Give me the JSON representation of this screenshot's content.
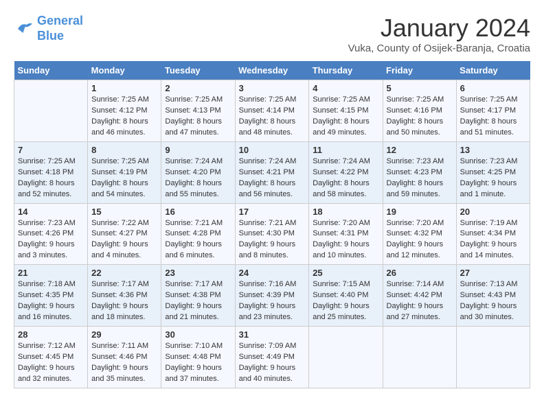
{
  "logo": {
    "line1": "General",
    "line2": "Blue"
  },
  "title": "January 2024",
  "location": "Vuka, County of Osijek-Baranja, Croatia",
  "weekdays": [
    "Sunday",
    "Monday",
    "Tuesday",
    "Wednesday",
    "Thursday",
    "Friday",
    "Saturday"
  ],
  "weeks": [
    [
      {
        "day": "",
        "info": ""
      },
      {
        "day": "1",
        "info": "Sunrise: 7:25 AM\nSunset: 4:12 PM\nDaylight: 8 hours\nand 46 minutes."
      },
      {
        "day": "2",
        "info": "Sunrise: 7:25 AM\nSunset: 4:13 PM\nDaylight: 8 hours\nand 47 minutes."
      },
      {
        "day": "3",
        "info": "Sunrise: 7:25 AM\nSunset: 4:14 PM\nDaylight: 8 hours\nand 48 minutes."
      },
      {
        "day": "4",
        "info": "Sunrise: 7:25 AM\nSunset: 4:15 PM\nDaylight: 8 hours\nand 49 minutes."
      },
      {
        "day": "5",
        "info": "Sunrise: 7:25 AM\nSunset: 4:16 PM\nDaylight: 8 hours\nand 50 minutes."
      },
      {
        "day": "6",
        "info": "Sunrise: 7:25 AM\nSunset: 4:17 PM\nDaylight: 8 hours\nand 51 minutes."
      }
    ],
    [
      {
        "day": "7",
        "info": "Sunrise: 7:25 AM\nSunset: 4:18 PM\nDaylight: 8 hours\nand 52 minutes."
      },
      {
        "day": "8",
        "info": "Sunrise: 7:25 AM\nSunset: 4:19 PM\nDaylight: 8 hours\nand 54 minutes."
      },
      {
        "day": "9",
        "info": "Sunrise: 7:24 AM\nSunset: 4:20 PM\nDaylight: 8 hours\nand 55 minutes."
      },
      {
        "day": "10",
        "info": "Sunrise: 7:24 AM\nSunset: 4:21 PM\nDaylight: 8 hours\nand 56 minutes."
      },
      {
        "day": "11",
        "info": "Sunrise: 7:24 AM\nSunset: 4:22 PM\nDaylight: 8 hours\nand 58 minutes."
      },
      {
        "day": "12",
        "info": "Sunrise: 7:23 AM\nSunset: 4:23 PM\nDaylight: 8 hours\nand 59 minutes."
      },
      {
        "day": "13",
        "info": "Sunrise: 7:23 AM\nSunset: 4:25 PM\nDaylight: 9 hours\nand 1 minute."
      }
    ],
    [
      {
        "day": "14",
        "info": "Sunrise: 7:23 AM\nSunset: 4:26 PM\nDaylight: 9 hours\nand 3 minutes."
      },
      {
        "day": "15",
        "info": "Sunrise: 7:22 AM\nSunset: 4:27 PM\nDaylight: 9 hours\nand 4 minutes."
      },
      {
        "day": "16",
        "info": "Sunrise: 7:21 AM\nSunset: 4:28 PM\nDaylight: 9 hours\nand 6 minutes."
      },
      {
        "day": "17",
        "info": "Sunrise: 7:21 AM\nSunset: 4:30 PM\nDaylight: 9 hours\nand 8 minutes."
      },
      {
        "day": "18",
        "info": "Sunrise: 7:20 AM\nSunset: 4:31 PM\nDaylight: 9 hours\nand 10 minutes."
      },
      {
        "day": "19",
        "info": "Sunrise: 7:20 AM\nSunset: 4:32 PM\nDaylight: 9 hours\nand 12 minutes."
      },
      {
        "day": "20",
        "info": "Sunrise: 7:19 AM\nSunset: 4:34 PM\nDaylight: 9 hours\nand 14 minutes."
      }
    ],
    [
      {
        "day": "21",
        "info": "Sunrise: 7:18 AM\nSunset: 4:35 PM\nDaylight: 9 hours\nand 16 minutes."
      },
      {
        "day": "22",
        "info": "Sunrise: 7:17 AM\nSunset: 4:36 PM\nDaylight: 9 hours\nand 18 minutes."
      },
      {
        "day": "23",
        "info": "Sunrise: 7:17 AM\nSunset: 4:38 PM\nDaylight: 9 hours\nand 21 minutes."
      },
      {
        "day": "24",
        "info": "Sunrise: 7:16 AM\nSunset: 4:39 PM\nDaylight: 9 hours\nand 23 minutes."
      },
      {
        "day": "25",
        "info": "Sunrise: 7:15 AM\nSunset: 4:40 PM\nDaylight: 9 hours\nand 25 minutes."
      },
      {
        "day": "26",
        "info": "Sunrise: 7:14 AM\nSunset: 4:42 PM\nDaylight: 9 hours\nand 27 minutes."
      },
      {
        "day": "27",
        "info": "Sunrise: 7:13 AM\nSunset: 4:43 PM\nDaylight: 9 hours\nand 30 minutes."
      }
    ],
    [
      {
        "day": "28",
        "info": "Sunrise: 7:12 AM\nSunset: 4:45 PM\nDaylight: 9 hours\nand 32 minutes."
      },
      {
        "day": "29",
        "info": "Sunrise: 7:11 AM\nSunset: 4:46 PM\nDaylight: 9 hours\nand 35 minutes."
      },
      {
        "day": "30",
        "info": "Sunrise: 7:10 AM\nSunset: 4:48 PM\nDaylight: 9 hours\nand 37 minutes."
      },
      {
        "day": "31",
        "info": "Sunrise: 7:09 AM\nSunset: 4:49 PM\nDaylight: 9 hours\nand 40 minutes."
      },
      {
        "day": "",
        "info": ""
      },
      {
        "day": "",
        "info": ""
      },
      {
        "day": "",
        "info": ""
      }
    ]
  ]
}
